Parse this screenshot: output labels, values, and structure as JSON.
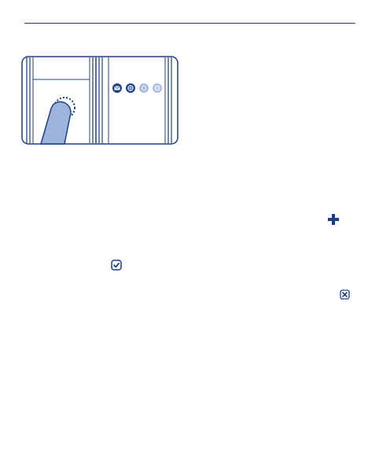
{
  "colors": {
    "accent_dark": "#1b3f8b",
    "accent_mid": "#3460b8",
    "finger_fill": "#9fb4da",
    "icon_light": "#a9bde3"
  },
  "illustration": {
    "description_icons": [
      "hand-pointer-icon",
      "touch-target-dotted-circle"
    ],
    "app_icons": [
      "mail-icon",
      "web-icon",
      "settings-icon",
      "email-at-icon"
    ]
  },
  "inline_icons": {
    "add": "plus-icon",
    "confirm": "checkbox-check-icon",
    "remove": "close-box-icon"
  }
}
